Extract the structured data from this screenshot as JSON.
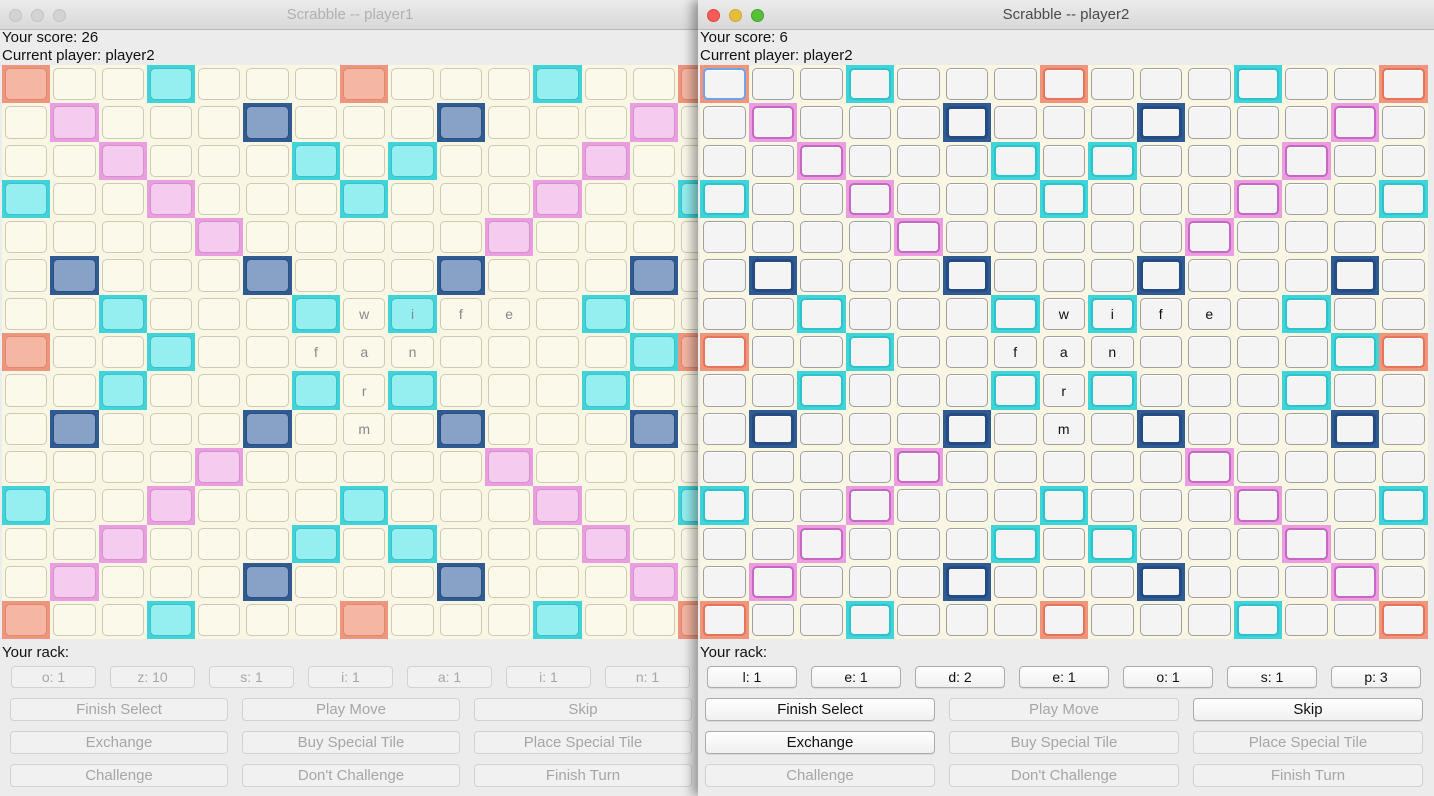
{
  "window1": {
    "title": "Scrabble -- player1",
    "score": "Your score: 26",
    "current": "Current player: player2",
    "rack_label": "Your rack:",
    "rack": [
      "o: 1",
      "z: 10",
      "s: 1",
      "i: 1",
      "a: 1",
      "i: 1",
      "n: 1"
    ],
    "buttons": [
      "Finish Select",
      "Play Move",
      "Skip",
      "Exchange",
      "Buy Special Tile",
      "Place Special Tile",
      "Challenge",
      "Don't Challenge",
      "Finish Turn"
    ],
    "button_enabled": [
      false,
      false,
      false,
      false,
      false,
      false,
      false,
      false,
      false
    ]
  },
  "window2": {
    "title": "Scrabble -- player2",
    "score": "Your score: 6",
    "current": "Current player: player2",
    "rack_label": "Your rack:",
    "rack": [
      "l: 1",
      "e: 1",
      "d: 2",
      "e: 1",
      "o: 1",
      "s: 1",
      "p: 3"
    ],
    "buttons": [
      "Finish Select",
      "Play Move",
      "Skip",
      "Exchange",
      "Buy Special Tile",
      "Place Special Tile",
      "Challenge",
      "Don't Challenge",
      "Finish Turn"
    ],
    "button_enabled": [
      true,
      false,
      true,
      true,
      false,
      false,
      false,
      false,
      false
    ]
  },
  "board": {
    "layout": [
      "T..d...T...d..T",
      ".D...t...t...D.",
      "..D...d.d...D..",
      "d..D...d...D..d",
      "....D.....D....",
      ".t...t...t...t.",
      "..d...d.d...d..",
      "T..d.........dT",
      "..d...d.d...d..",
      ".t...t...t...t.",
      "....D.....D....",
      "d..D...d...D..d",
      "..D...d.d...D..",
      ".D...t...t...D.",
      "T..d...T...d..T"
    ],
    "letters": [
      {
        "row": 6,
        "col": 7,
        "ch": "w"
      },
      {
        "row": 6,
        "col": 8,
        "ch": "i"
      },
      {
        "row": 6,
        "col": 9,
        "ch": "f"
      },
      {
        "row": 6,
        "col": 10,
        "ch": "e"
      },
      {
        "row": 7,
        "col": 6,
        "ch": "f"
      },
      {
        "row": 7,
        "col": 7,
        "ch": "a"
      },
      {
        "row": 7,
        "col": 8,
        "ch": "n"
      },
      {
        "row": 8,
        "col": 7,
        "ch": "r"
      },
      {
        "row": 9,
        "col": 7,
        "ch": "m"
      }
    ]
  },
  "colors": {
    "triple_word": "#f0957d",
    "double_word": "#ea9ee0",
    "triple_letter": "#2f5b92",
    "double_letter": "#40d3d8",
    "board_bg": "#f9f6e4"
  }
}
